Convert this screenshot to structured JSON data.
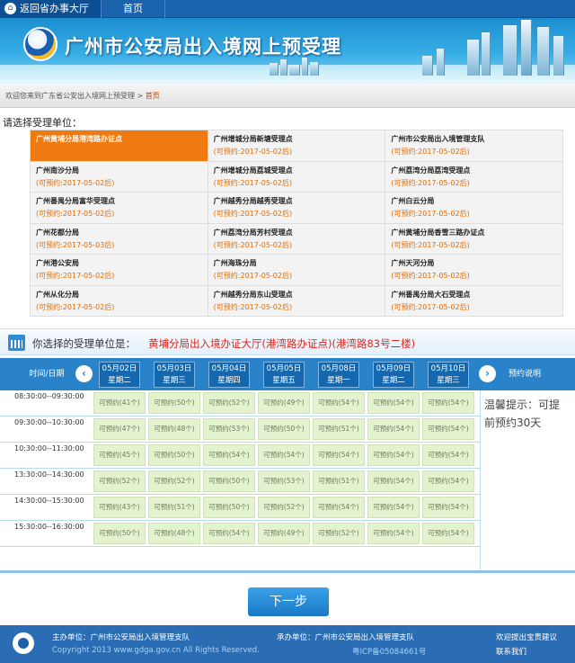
{
  "topbar": {
    "back_label": "返回省办事大厅",
    "home_label": "首页"
  },
  "banner": {
    "title": "广州市公安局出入境网上预受理"
  },
  "breadcrumb": {
    "prefix": "欢迎您来到广东省公安出入境网上预受理 >",
    "current": "首页"
  },
  "prompt": "请选择受理单位：",
  "units": [
    [
      {
        "name": "广州黄埔分局港湾路办证点",
        "status": ""
      },
      {
        "name": "广州增城分局新塘受理点",
        "status": "(可预约:2017-05-02后)"
      },
      {
        "name": "广州市公安局出入境管理支队",
        "status": "(可预约:2017-05-02后)"
      }
    ],
    [
      {
        "name": "广州南沙分局",
        "status": "(可预约:2017-05-02后)"
      },
      {
        "name": "广州增城分局荔城受理点",
        "status": "(可预约:2017-05-02后)"
      },
      {
        "name": "广州荔湾分局荔湾受理点",
        "status": "(可预约:2017-05-02后)"
      }
    ],
    [
      {
        "name": "广州番禺分局富华受理点",
        "status": "(可预约:2017-05-02后)"
      },
      {
        "name": "广州越秀分局越秀受理点",
        "status": "(可预约:2017-05-02后)"
      },
      {
        "name": "广州白云分局",
        "status": "(可预约:2017-05-02后)"
      }
    ],
    [
      {
        "name": "广州花都分局",
        "status": "(可预约:2017-05-03后)"
      },
      {
        "name": "广州荔湾分局芳村受理点",
        "status": "(可预约:2017-05-02后)"
      },
      {
        "name": "广州黄埔分局香雪三路办证点",
        "status": "(可预约:2017-05-02后)"
      }
    ],
    [
      {
        "name": "广州港公安局",
        "status": "(可预约:2017-05-02后)"
      },
      {
        "name": "广州海珠分局",
        "status": "(可预约:2017-05-02后)"
      },
      {
        "name": "广州天河分局",
        "status": "(可预约:2017-05-02后)"
      }
    ],
    [
      {
        "name": "广州从化分局",
        "status": "(可预约:2017-05-02后)"
      },
      {
        "name": "广州越秀分局东山受理点",
        "status": "(可预约:2017-05-02后)"
      },
      {
        "name": "广州番禺分局大石受理点",
        "status": "(可预约:2017-05-02后)"
      }
    ]
  ],
  "chosen": {
    "label": "你选择的受理单位是：",
    "value": "黄埔分局出入境办证大厅(港湾路办证点)(港湾路83号二楼)"
  },
  "schedule": {
    "time_header": "时间/日期",
    "note_header": "预约说明",
    "prev_label": "‹",
    "next_label": "›",
    "days": [
      {
        "date": "05月02日",
        "weekday": "星期二"
      },
      {
        "date": "05月03日",
        "weekday": "星期三"
      },
      {
        "date": "05月04日",
        "weekday": "星期四"
      },
      {
        "date": "05月05日",
        "weekday": "星期五"
      },
      {
        "date": "05月08日",
        "weekday": "星期一"
      },
      {
        "date": "05月09日",
        "weekday": "星期二"
      },
      {
        "date": "05月10日",
        "weekday": "星期三"
      }
    ],
    "rows": [
      {
        "time": "08:30:00--09:30:00",
        "slots": [
          "可预约(41个)",
          "可预约(50个)",
          "可预约(52个)",
          "可预约(49个)",
          "可预约(54个)",
          "可预约(54个)",
          "可预约(54个)"
        ]
      },
      {
        "time": "09:30:00--10:30:00",
        "slots": [
          "可预约(47个)",
          "可预约(48个)",
          "可预约(53个)",
          "可预约(50个)",
          "可预约(51个)",
          "可预约(54个)",
          "可预约(54个)"
        ]
      },
      {
        "time": "10:30:00--11:30:00",
        "slots": [
          "可预约(45个)",
          "可预约(50个)",
          "可预约(54个)",
          "可预约(54个)",
          "可预约(54个)",
          "可预约(54个)",
          "可预约(54个)"
        ]
      },
      {
        "time": "13:30:00--14:30:00",
        "slots": [
          "可预约(52个)",
          "可预约(52个)",
          "可预约(50个)",
          "可预约(53个)",
          "可预约(51个)",
          "可预约(54个)",
          "可预约(54个)"
        ]
      },
      {
        "time": "14:30:00--15:30:00",
        "slots": [
          "可预约(43个)",
          "可预约(51个)",
          "可预约(50个)",
          "可预约(52个)",
          "可预约(54个)",
          "可预约(54个)",
          "可预约(54个)"
        ]
      },
      {
        "time": "15:30:00--16:30:00",
        "slots": [
          "可预约(50个)",
          "可预约(48个)",
          "可预约(54个)",
          "可预约(49个)",
          "可预约(52个)",
          "可预约(54个)",
          "可预约(54个)"
        ]
      }
    ],
    "tip": "温馨提示：可提前预约30天"
  },
  "next_button": "下一步",
  "footer": {
    "host": "主办单位：广州市公安局出入境管理支队",
    "undertaker": "承办单位：广州市公安局出入境管理支队",
    "copyright": "Copyright 2013 www.gdga.gov.cn All Rights Reserved.",
    "icp": "粤ICP备05084661号",
    "feedback": "欢迎提出宝贵建议",
    "contact": "联系我们"
  },
  "colors": {
    "accent": "#2a83c9",
    "selected": "#f07a12",
    "status": "#e06b00",
    "chosen_value": "#e0241b",
    "slot_bg": "#e3f3d0"
  }
}
